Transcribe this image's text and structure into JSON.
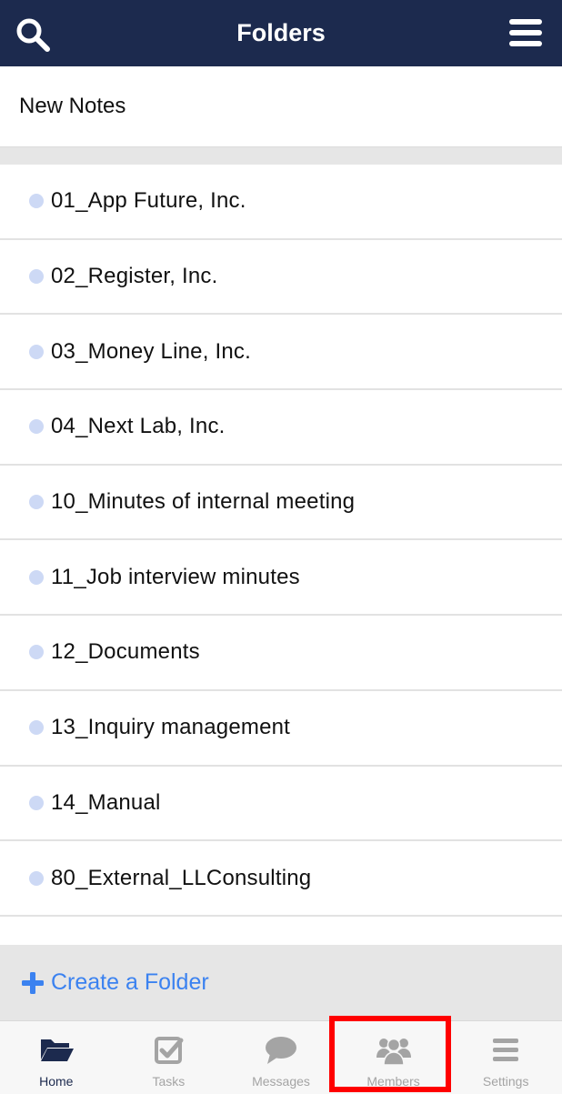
{
  "header": {
    "title": "Folders",
    "left_icon": "search-icon",
    "right_icon": "hamburger-menu-icon",
    "background_color": "#1c2a4e"
  },
  "new_notes": {
    "label": "New Notes"
  },
  "folders": [
    {
      "label": "01_App Future, Inc."
    },
    {
      "label": "02_Register, Inc."
    },
    {
      "label": "03_Money Line, Inc."
    },
    {
      "label": "04_Next Lab, Inc."
    },
    {
      "label": "10_Minutes of internal meeting"
    },
    {
      "label": "11_Job interview minutes"
    },
    {
      "label": "12_Documents"
    },
    {
      "label": "13_Inquiry management"
    },
    {
      "label": "14_Manual"
    },
    {
      "label": "80_External_LLConsulting"
    }
  ],
  "create_folder": {
    "label": "Create a Folder",
    "icon": "plus-icon",
    "color": "#3b82f0"
  },
  "tabbar": {
    "tabs": [
      {
        "label": "Home",
        "icon": "folder-open-icon",
        "active": true
      },
      {
        "label": "Tasks",
        "icon": "checkbox-icon",
        "active": false
      },
      {
        "label": "Messages",
        "icon": "chat-bubble-icon",
        "active": false
      },
      {
        "label": "Members",
        "icon": "users-icon",
        "active": false,
        "highlighted": true
      },
      {
        "label": "Settings",
        "icon": "list-icon",
        "active": false
      }
    ]
  },
  "colors": {
    "highlight": "#ff0000",
    "dot": "#cdd9f5",
    "tab_active": "#1c2a4e",
    "tab_inactive": "#a4a4a4"
  }
}
